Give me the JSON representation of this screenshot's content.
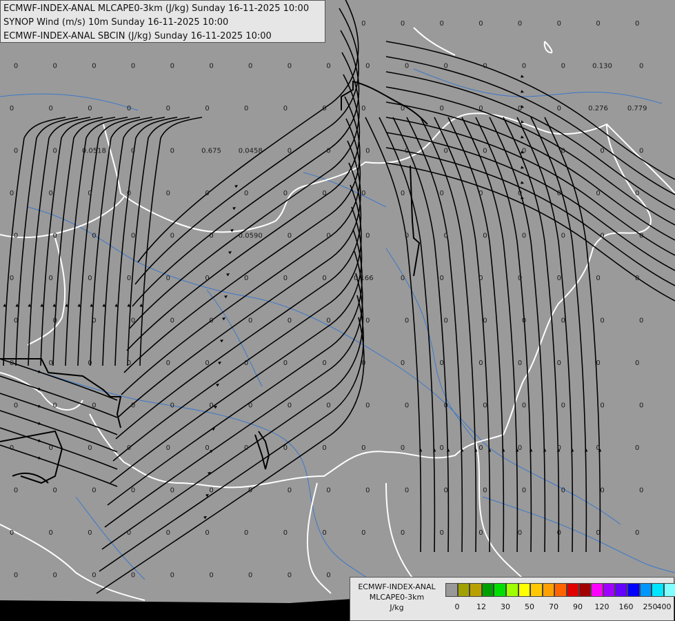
{
  "header": {
    "line1": "ECMWF-INDEX-ANAL MLCAPE0-3km (J/kg) Sunday 16-11-2025 10:00",
    "line2": "SYNOP Wind (m/s) 10m Sunday 16-11-2025 10:00",
    "line3": "ECMWF-INDEX-ANAL SBCIN (J/kg) Sunday 16-11-2025 10:00"
  },
  "legend": {
    "label_line1": "ECMWF-INDEX-ANAL",
    "label_line2": "MLCAPE0-3km",
    "label_line3": "J/kg",
    "colors": [
      "#999999",
      "#a0a000",
      "#b8a000",
      "#00a000",
      "#00e000",
      "#a0ff00",
      "#ffff00",
      "#ffc800",
      "#ffa000",
      "#ff6400",
      "#e00000",
      "#a00000",
      "#ff00ff",
      "#a000ff",
      "#6400ff",
      "#0000ff",
      "#0096ff",
      "#00e6ff",
      "#80ffff",
      "#ffffff"
    ],
    "ticks": [
      "0",
      "12",
      "30",
      "50",
      "70",
      "90",
      "120",
      "160",
      "250",
      "400"
    ]
  },
  "annotations": [
    {
      "text": "0.0518",
      "col": 2,
      "row": 3
    },
    {
      "text": "0.675",
      "col": 5,
      "row": 3
    },
    {
      "text": "0.0458",
      "col": 6,
      "row": 3
    },
    {
      "text": "0.0590",
      "col": 6,
      "row": 5
    },
    {
      "text": "0.166",
      "col": 9,
      "row": 6
    },
    {
      "text": "0.130",
      "col": 15,
      "row": 1
    },
    {
      "text": "0.276",
      "col": 15,
      "row": 2
    },
    {
      "text": "0.779",
      "col": 16,
      "row": 2
    }
  ],
  "grid_value": "0"
}
